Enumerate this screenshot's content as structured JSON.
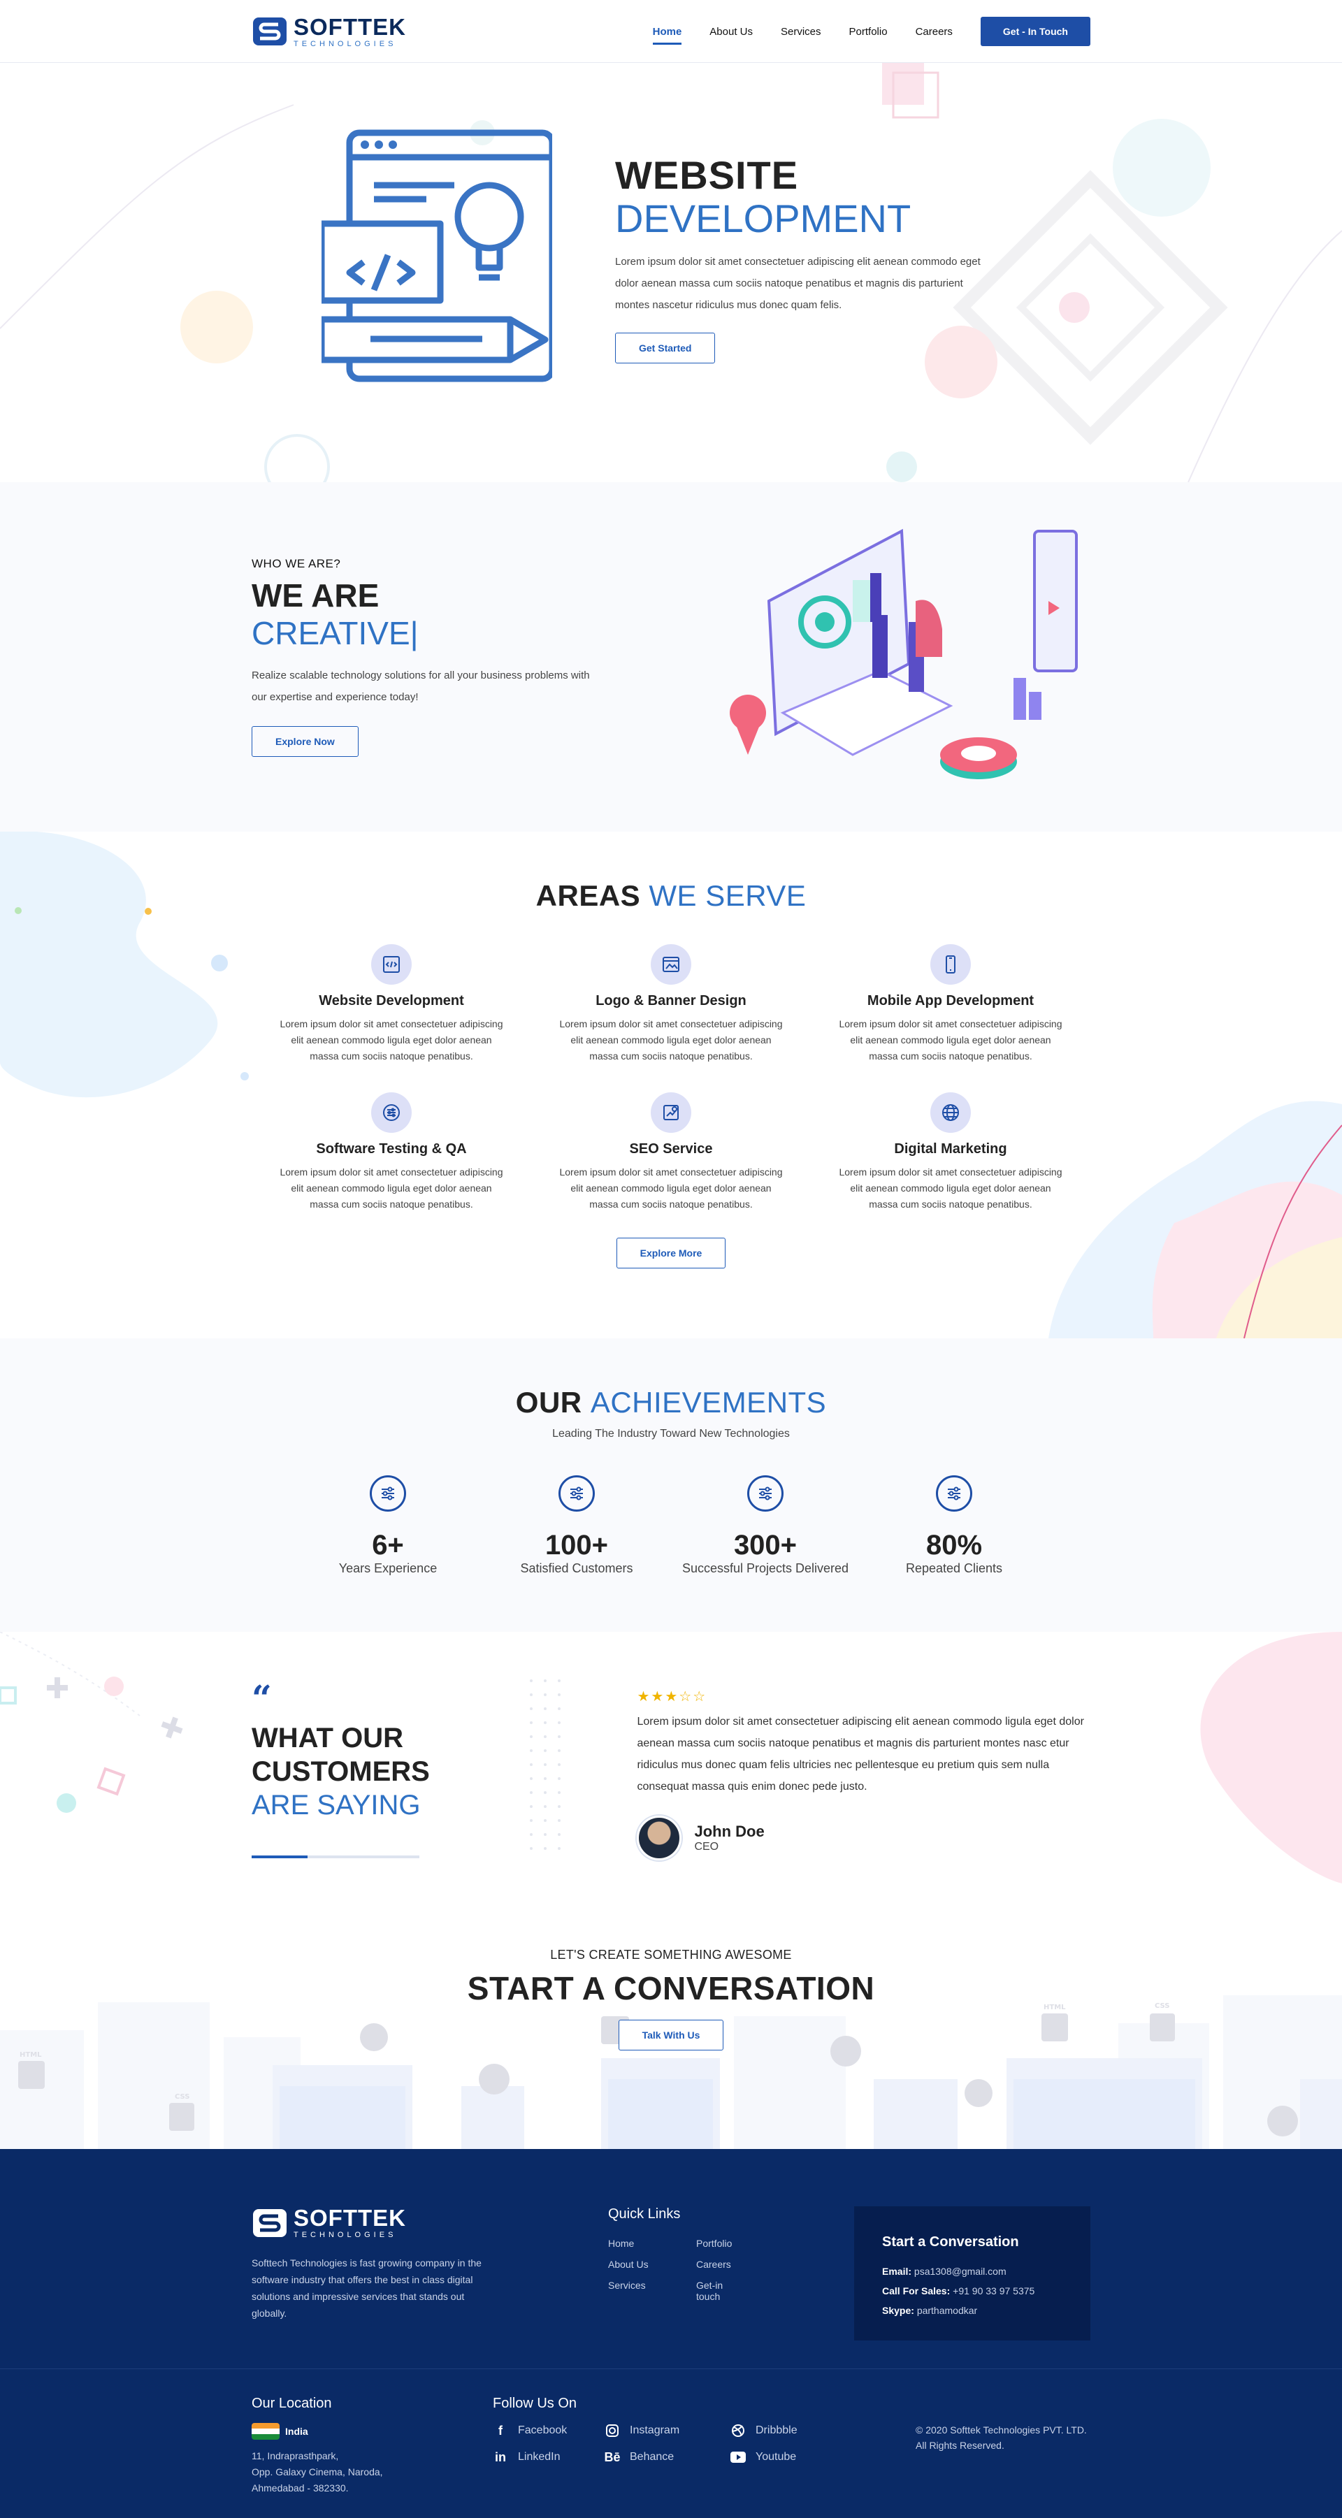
{
  "brand": {
    "name": "SOFTTEK",
    "tagline": "TECHNOLOGIES"
  },
  "nav": {
    "items": [
      {
        "label": "Home",
        "active": true
      },
      {
        "label": "About Us"
      },
      {
        "label": "Services"
      },
      {
        "label": "Portfolio"
      },
      {
        "label": "Careers"
      }
    ],
    "cta": "Get - In Touch"
  },
  "hero": {
    "title_line1": "WEBSITE",
    "title_line2": "DEVELOPMENT",
    "body": "Lorem ipsum dolor sit amet consectetuer adipiscing elit aenean commodo eget dolor aenean massa cum sociis natoque penatibus et magnis dis parturient montes nascetur ridiculus mus donec quam felis.",
    "button": "Get Started",
    "slides_total": 5,
    "active_slide": 1
  },
  "who": {
    "kicker": "WHO WE ARE?",
    "title": "WE ARE",
    "typed": "CREATIVE|",
    "body": "Realize scalable technology solutions for all your business problems with our expertise and experience today!",
    "button": "Explore Now"
  },
  "areas": {
    "title_a": "AREAS",
    "title_b": "WE SERVE",
    "services": [
      {
        "name": "Website Development",
        "icon": "code-window-icon",
        "desc": "Lorem ipsum dolor sit amet consectetuer adipiscing elit aenean commodo ligula eget dolor aenean massa cum sociis natoque penatibus."
      },
      {
        "name": "Logo & Banner Design",
        "icon": "image-frame-icon",
        "desc": "Lorem ipsum dolor sit amet consectetuer adipiscing elit aenean commodo ligula eget dolor aenean massa cum sociis natoque penatibus."
      },
      {
        "name": "Mobile App Development",
        "icon": "mobile-phone-icon",
        "desc": "Lorem ipsum dolor sit amet consectetuer adipiscing elit aenean commodo ligula eget dolor aenean massa cum sociis natoque penatibus."
      },
      {
        "name": "Software Testing & QA",
        "icon": "sliders-icon",
        "desc": "Lorem ipsum dolor sit amet consectetuer adipiscing elit aenean commodo ligula eget dolor aenean massa cum sociis natoque penatibus."
      },
      {
        "name": "SEO Service",
        "icon": "seo-chart-icon",
        "desc": "Lorem ipsum dolor sit amet consectetuer adipiscing elit aenean commodo ligula eget dolor aenean massa cum sociis natoque penatibus."
      },
      {
        "name": "Digital Marketing",
        "icon": "globe-icon",
        "desc": "Lorem ipsum dolor sit amet consectetuer adipiscing elit aenean commodo ligula eget dolor aenean massa cum sociis natoque penatibus."
      }
    ],
    "button": "Explore More"
  },
  "achievements": {
    "title_a": "OUR",
    "title_b": "ACHIEVEMENTS",
    "lead": "Leading The Industry Toward New Technologies",
    "stats": [
      {
        "value": "6+",
        "label": "Years Experience"
      },
      {
        "value": "100+",
        "label": "Satisfied Customers"
      },
      {
        "value": "300+",
        "label": "Successful Projects Delivered"
      },
      {
        "value": "80%",
        "label": "Repeated Clients"
      }
    ]
  },
  "testimonial": {
    "quote_mark": "66",
    "line1": "WHAT OUR",
    "line2": "CUSTOMERS",
    "line3": "ARE SAYING",
    "rating": 3,
    "rating_max": 5,
    "text": "Lorem ipsum dolor sit amet consectetuer adipiscing elit aenean commodo ligula eget dolor aenean massa cum sociis natoque penatibus et magnis dis parturient montes nasc etur ridiculus mus donec quam felis ultricies nec pellentesque eu pretium quis sem nulla consequat massa quis enim donec pede justo.",
    "name": "John Doe",
    "role": "CEO"
  },
  "conversation": {
    "kicker": "LET'S CREATE SOMETHING AWESOME",
    "title": "START A CONVERSATION",
    "button": "Talk With Us"
  },
  "footer": {
    "about": "Softtech Technologies is fast growing company in the software industry that offers the best in class digital solutions and impressive services that stands out globally.",
    "quick_links_title": "Quick Links",
    "links_col1": [
      "Home",
      "About Us",
      "Services"
    ],
    "links_col2": [
      "Portfolio",
      "Careers",
      "Get-in touch"
    ],
    "contact": {
      "title": "Start a Conversation",
      "email_label": "Email:",
      "email": "psa1308@gmail.com",
      "sales_label": "Call For Sales:",
      "sales": "+91 90 33 97 5375",
      "skype_label": "Skype:",
      "skype": "parthamodkar"
    },
    "location_title": "Our Location",
    "country": "India",
    "address": [
      "11, Indraprasthpark,",
      "Opp. Galaxy Cinema, Naroda,",
      "Ahmedabad - 382330."
    ],
    "follow_title": "Follow Us On",
    "social": [
      {
        "label": "Facebook",
        "icon": "facebook-icon"
      },
      {
        "label": "Instagram",
        "icon": "instagram-icon"
      },
      {
        "label": "Dribbble",
        "icon": "dribbble-icon"
      },
      {
        "label": "LinkedIn",
        "icon": "linkedin-icon"
      },
      {
        "label": "Behance",
        "icon": "behance-icon"
      },
      {
        "label": "Youtube",
        "icon": "youtube-icon"
      }
    ],
    "copyright_1": "© 2020 Softtek Technologies PVT. LTD.",
    "copyright_2": "All Rights Reserved."
  },
  "colors": {
    "primary": "#1e4ea6",
    "accent": "#2f72c4",
    "footer": "#0a2a66",
    "star": "#f0b400"
  }
}
